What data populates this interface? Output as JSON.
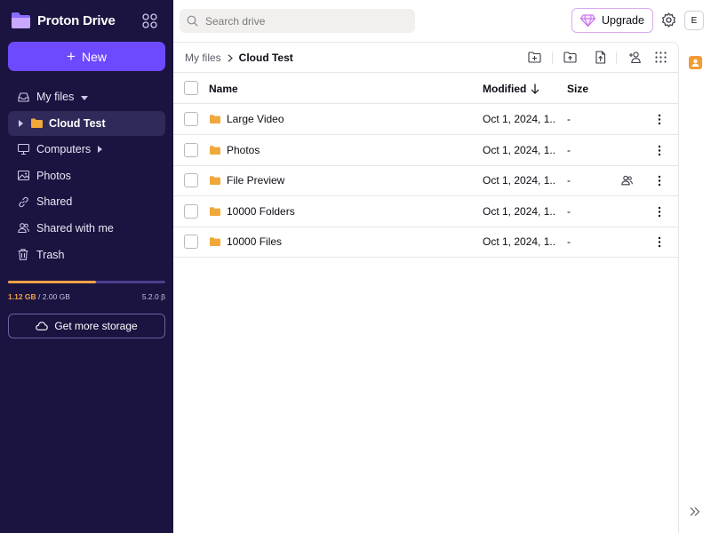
{
  "app": {
    "name": "Proton Drive",
    "brand_color": "#6d4aff",
    "sidebar_bg": "#1b1340"
  },
  "sidebar": {
    "new_label": "New",
    "items": [
      {
        "label": "My files",
        "icon": "inbox-icon",
        "has_caret": true
      },
      {
        "label": "Cloud Test",
        "icon": "folder-icon",
        "active": true
      },
      {
        "label": "Computers",
        "icon": "monitor-icon",
        "has_caret": true
      },
      {
        "label": "Photos",
        "icon": "image-icon"
      },
      {
        "label": "Shared",
        "icon": "link-icon"
      },
      {
        "label": "Shared with me",
        "icon": "users-icon"
      },
      {
        "label": "Trash",
        "icon": "trash-icon"
      }
    ],
    "storage": {
      "used": "1.12 GB",
      "separator": " / ",
      "total": "2.00 GB",
      "fraction": 0.56,
      "version": "5.2.0 β"
    },
    "get_more_storage_label": "Get more storage"
  },
  "topbar": {
    "search_placeholder": "Search drive",
    "upgrade_label": "Upgrade",
    "avatar_initial": "E"
  },
  "main": {
    "breadcrumb": {
      "root": "My files",
      "current": "Cloud Test"
    },
    "columns": {
      "name": "Name",
      "modified": "Modified",
      "size": "Size"
    },
    "rows": [
      {
        "name": "Large Video",
        "modified": "Oct 1, 2024, 1...",
        "size": "-",
        "shared": false
      },
      {
        "name": "Photos",
        "modified": "Oct 1, 2024, 1...",
        "size": "-",
        "shared": false
      },
      {
        "name": "File Preview",
        "modified": "Oct 1, 2024, 1...",
        "size": "-",
        "shared": true
      },
      {
        "name": "10000 Folders",
        "modified": "Oct 1, 2024, 1...",
        "size": "-",
        "shared": false
      },
      {
        "name": "10000 Files",
        "modified": "Oct 1, 2024, 1...",
        "size": "-",
        "shared": false
      }
    ],
    "folder_color": "#f0a83a"
  }
}
